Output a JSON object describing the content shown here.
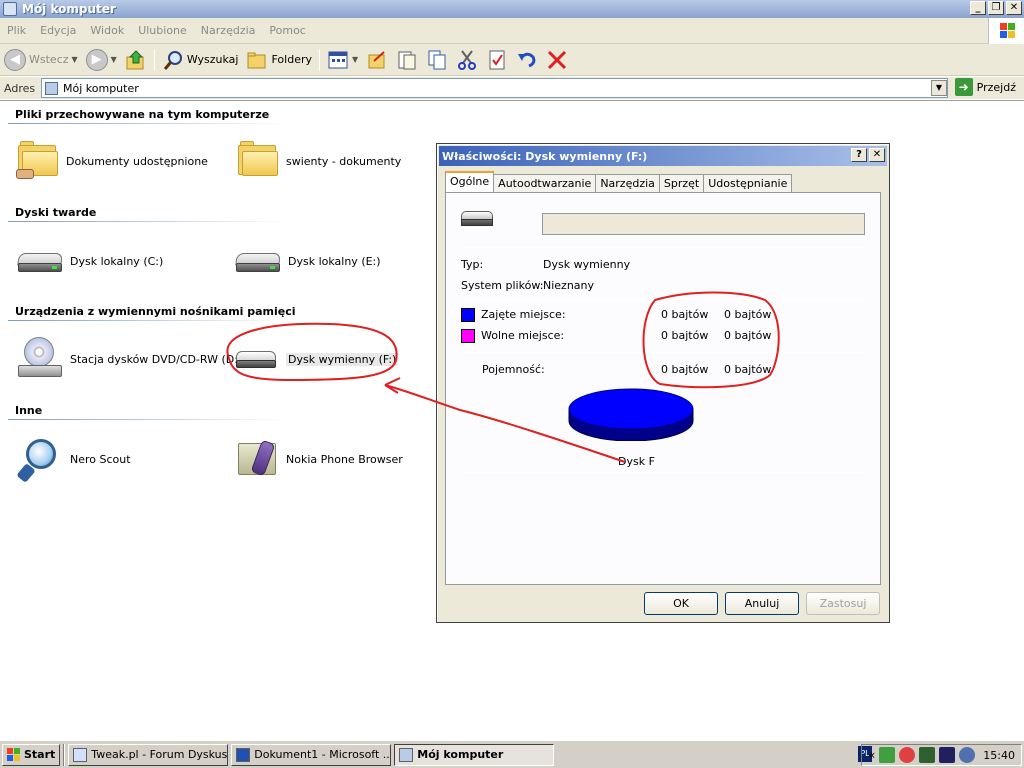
{
  "window": {
    "title": "Mój komputer"
  },
  "menu": {
    "items": [
      "Plik",
      "Edycja",
      "Widok",
      "Ulubione",
      "Narzędzia",
      "Pomoc"
    ]
  },
  "toolbar": {
    "back_label": "Wstecz",
    "search_label": "Wyszukaj",
    "folders_label": "Foldery"
  },
  "address": {
    "label": "Adres",
    "value": "Mój komputer",
    "go_label": "Przejdź"
  },
  "groups": {
    "files": {
      "header": "Pliki przechowywane na tym komputerze",
      "items": [
        "Dokumenty udostępnione",
        "swienty - dokumenty"
      ]
    },
    "hard": {
      "header": "Dyski twarde",
      "items": [
        "Dysk lokalny (C:)",
        "Dysk lokalny (E:)"
      ]
    },
    "removable": {
      "header": "Urządzenia z wymiennymi nośnikami pamięci",
      "items": [
        "Stacja dysków DVD/CD-RW (D:)",
        "Dysk wymienny (F:)"
      ]
    },
    "other": {
      "header": "Inne",
      "items": [
        "Nero Scout",
        "Nokia Phone Browser"
      ]
    }
  },
  "dialog": {
    "title": "Właściwości: Dysk wymienny (F:)",
    "tabs": [
      "Ogólne",
      "Autoodtwarzanie",
      "Narzędzia",
      "Sprzęt",
      "Udostępnianie"
    ],
    "type_label": "Typ:",
    "type_value": "Dysk wymienny",
    "fs_label": "System plików:",
    "fs_value": "Nieznany",
    "used_label": "Zajęte miejsce:",
    "used_bytes": "0 bajtów",
    "used_size": "0 bajtów",
    "free_label": "Wolne miejsce:",
    "free_bytes": "0 bajtów",
    "free_size": "0 bajtów",
    "capacity_label": "Pojemność:",
    "capacity_bytes": "0 bajtów",
    "capacity_size": "0 bajtów",
    "disk_label": "Dysk F",
    "ok": "OK",
    "cancel": "Anuluj",
    "apply": "Zastosuj",
    "colors": {
      "used": "#0000ff",
      "free": "#ff00ff",
      "pie": "#0000ff"
    }
  },
  "taskbar": {
    "start": "Start",
    "tasks": [
      "Tweak.pl - Forum Dyskus...",
      "Dokument1 - Microsoft ...",
      "Mój komputer"
    ],
    "lang": "PL",
    "clock": "15:40"
  }
}
